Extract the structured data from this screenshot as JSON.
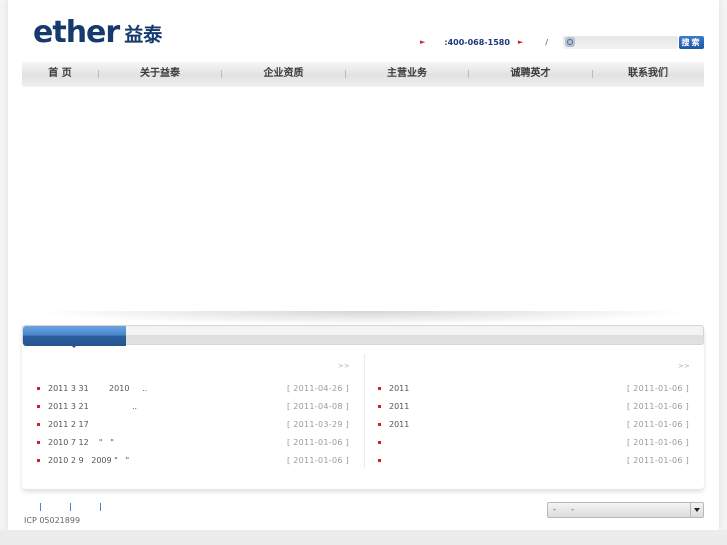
{
  "header": {
    "logo_en": "ether",
    "logo_cn": "益泰",
    "hotline": ":400-068-1580",
    "slash": "/",
    "search_placeholder": "",
    "search_button": "搜索"
  },
  "nav": {
    "items": [
      {
        "label": "首 页"
      },
      {
        "label": "关于益泰"
      },
      {
        "label": "企业资质"
      },
      {
        "label": "主营业务"
      },
      {
        "label": "诚聘英才"
      },
      {
        "label": "联系我们"
      }
    ]
  },
  "news": {
    "active_tab_label": "",
    "left": {
      "more": ">>",
      "items": [
        {
          "title": "2011 3 31        2010     ..",
          "date": "[ 2011-04-26 ]"
        },
        {
          "title": "2011 3 21                 ..",
          "date": "[ 2011-04-08 ]"
        },
        {
          "title": "2011 2 17",
          "date": "[ 2011-03-29 ]"
        },
        {
          "title": "2010 7 12    \"   \"",
          "date": "[ 2011-01-06 ]"
        },
        {
          "title": "2010 2 9   2009 \"   \"",
          "date": "[ 2011-01-06 ]"
        }
      ]
    },
    "right": {
      "more": ">>",
      "items": [
        {
          "title": "2011",
          "date": "[ 2011-01-06 ]"
        },
        {
          "title": "2011",
          "date": "[ 2011-01-06 ]"
        },
        {
          "title": "2011",
          "date": "[ 2011-01-06 ]"
        },
        {
          "title": "",
          "date": "[ 2011-01-06 ]"
        },
        {
          "title": "",
          "date": "[ 2011-01-06 ]"
        }
      ]
    }
  },
  "footer": {
    "icp": "ICP 05021899",
    "select_value": "-      -"
  },
  "colors": {
    "brand": "#163a6e",
    "accent_blue": "#2c5f9f",
    "bullet_red": "#d0202a"
  }
}
